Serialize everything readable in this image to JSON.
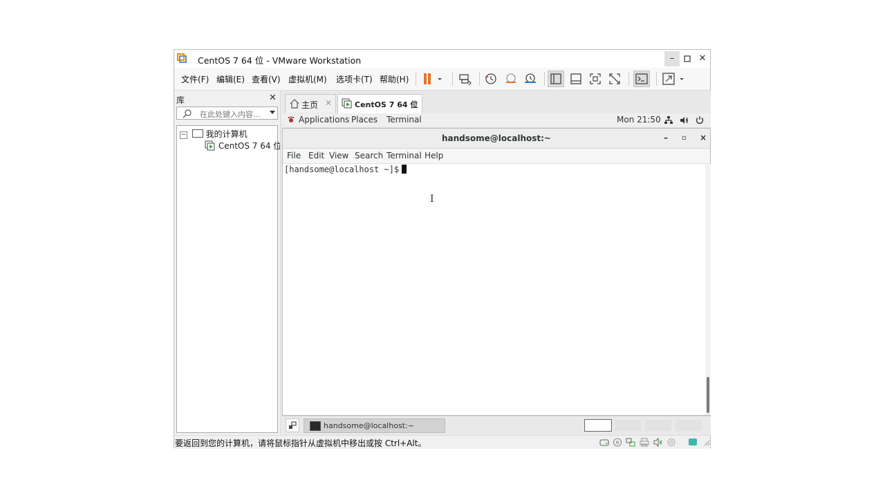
{
  "window": {
    "title": "CentOS 7 64 位 - VMware Workstation"
  },
  "menu": {
    "items": [
      {
        "label": "文件(F)"
      },
      {
        "label": "编辑(E)"
      },
      {
        "label": "查看(V)"
      },
      {
        "label": "虚拟机(M)"
      },
      {
        "label": "选项卡(T)"
      },
      {
        "label": "帮助(H)"
      }
    ]
  },
  "toolbar": {
    "icons": [
      "pause-icon",
      "send-ctrl-alt-del-icon",
      "snapshot-icon",
      "revert-snapshot-icon",
      "snapshot-manager-icon",
      "view-library-icon",
      "view-thumbnail-icon",
      "view-fullscreen-icon",
      "view-unity-icon",
      "console-icon",
      "stretch-icon"
    ]
  },
  "library": {
    "title": "库",
    "search_placeholder": "在此处键入内容...",
    "tree": {
      "root": "我的计算机",
      "child": "CentOS 7 64 位"
    }
  },
  "tabs": [
    {
      "label": "主页"
    },
    {
      "label": "CentOS 7 64 位"
    }
  ],
  "guest": {
    "topbar": {
      "applications": "Applications",
      "places": "Places",
      "terminal": "Terminal",
      "clock": "Mon 21:50"
    },
    "terminal": {
      "title": "handsome@localhost:~",
      "controls": {
        "minimize": "–",
        "maximize": "▫",
        "close": "×"
      },
      "menu": [
        "File",
        "Edit",
        "View",
        "Search",
        "Terminal",
        "Help"
      ],
      "prompt": "[handsome@localhost ~]$"
    },
    "taskbar": {
      "window_label": "handsome@localhost:~",
      "workspaces": 4,
      "current_workspace": 1
    }
  },
  "status": {
    "message": "要返回到您的计算机，请将鼠标指针从虚拟机中移出或按 Ctrl+Alt。",
    "icons": [
      "hdd-icon",
      "cd-icon",
      "network-icon",
      "printer-icon",
      "sound-icon",
      "usb-icon",
      "message-icon"
    ]
  },
  "colors": {
    "pause_orange": "#e8722a",
    "vmware_orange": "#f38b00",
    "vm_green": "#3aa63a"
  }
}
